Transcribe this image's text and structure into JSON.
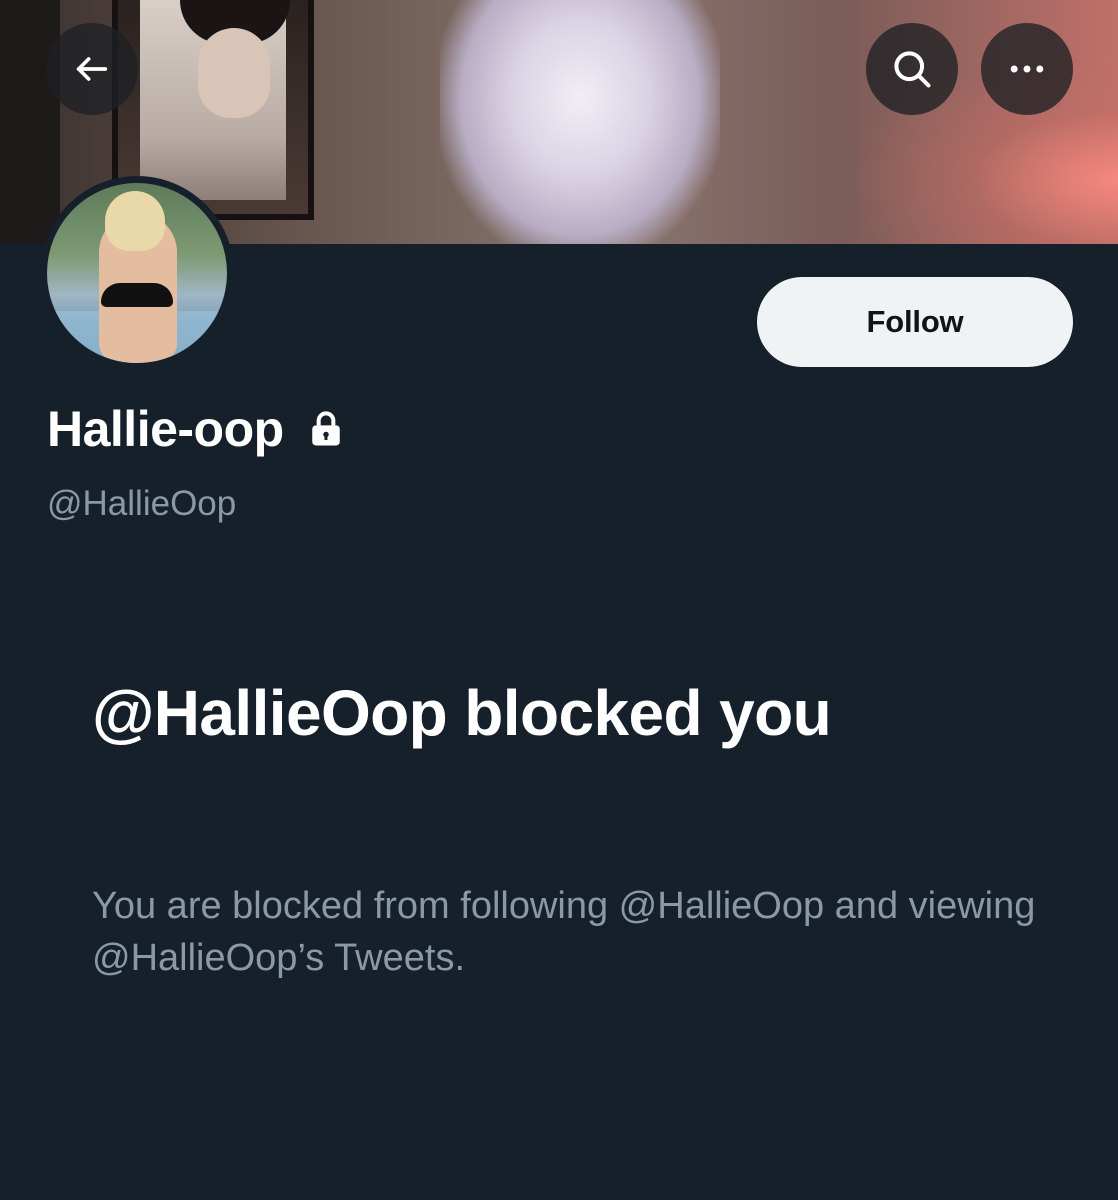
{
  "header": {
    "back_icon": "arrow-left-icon",
    "search_icon": "search-icon",
    "more_icon": "more-horizontal-icon"
  },
  "profile": {
    "display_name": "Hallie-oop",
    "protected_icon": "lock-icon",
    "handle": "@HallieOop",
    "follow_label": "Follow"
  },
  "blocked": {
    "title": "@HallieOop blocked you",
    "description": "You are blocked from following @HallieOop and viewing @HallieOop’s Tweets."
  },
  "colors": {
    "background": "#15202b",
    "primary_text": "#ffffff",
    "secondary_text": "#8b98a5",
    "follow_button_bg": "#eff3f4"
  }
}
